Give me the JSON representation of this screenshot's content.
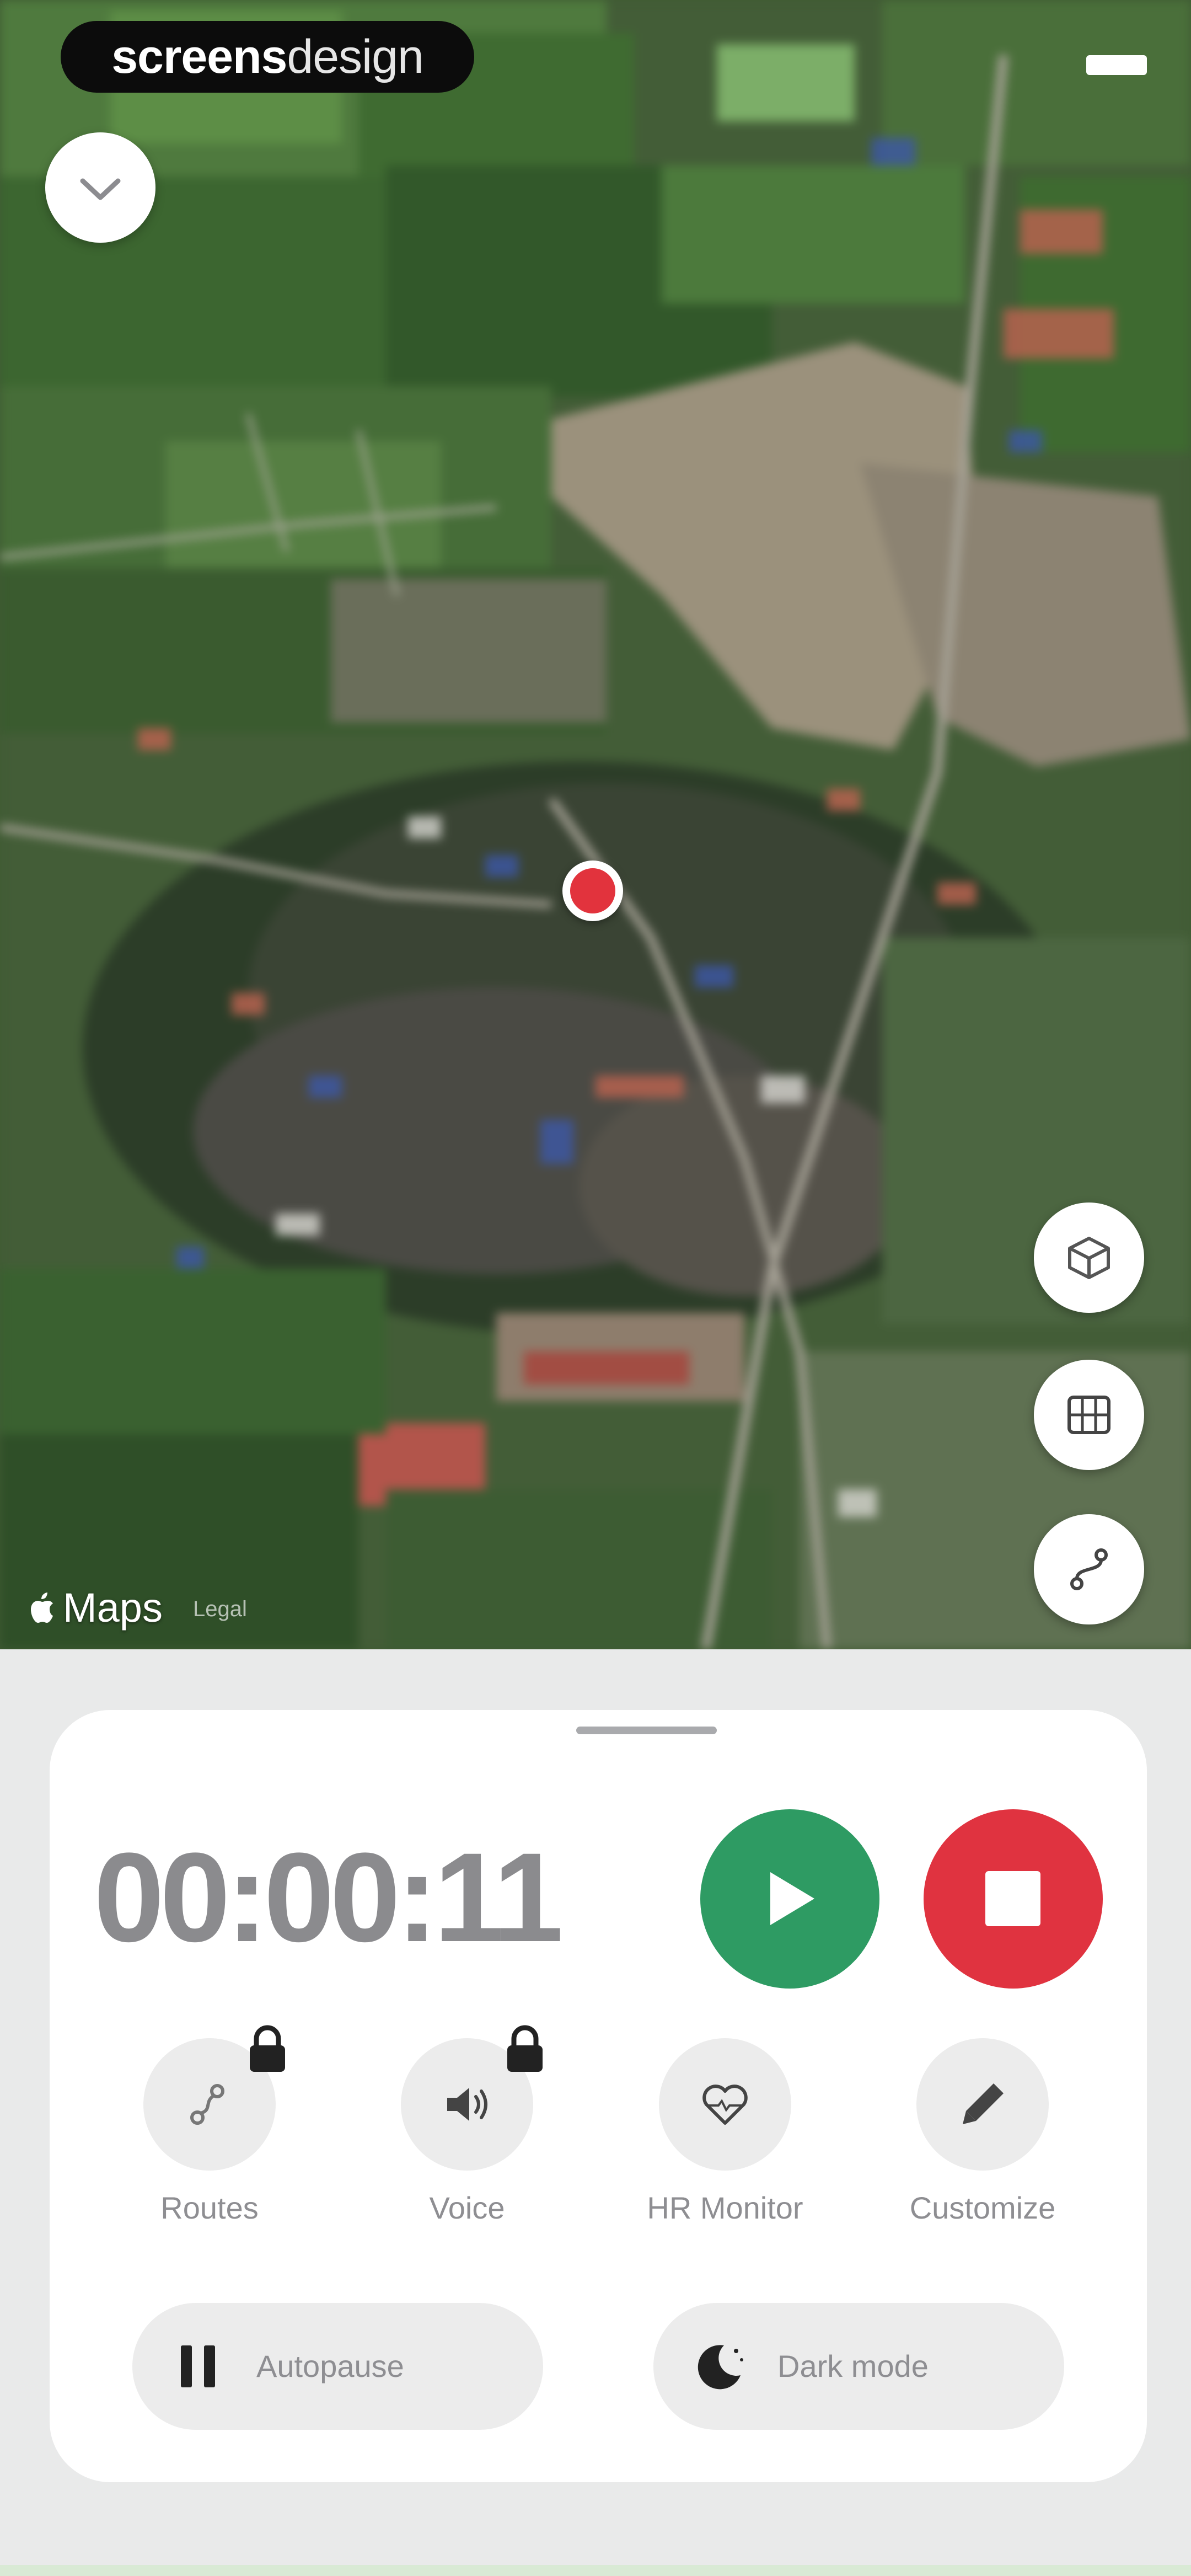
{
  "watermark": {
    "bold": "screens",
    "regular": "design"
  },
  "map": {
    "attribution": "Maps",
    "legal": "Legal",
    "controls": [
      {
        "name": "map-style-button",
        "icon": "cube-icon"
      },
      {
        "name": "map-layers-button",
        "icon": "map-grid-icon"
      },
      {
        "name": "route-button",
        "icon": "route-icon"
      }
    ]
  },
  "workout": {
    "elapsed": "00:00:11",
    "play_icon": "play-icon",
    "stop_icon": "stop-icon"
  },
  "features": [
    {
      "label": "Routes",
      "icon": "routes-icon",
      "locked": true
    },
    {
      "label": "Voice",
      "icon": "speaker-icon",
      "locked": true
    },
    {
      "label": "HR Monitor",
      "icon": "heart-icon",
      "locked": false
    },
    {
      "label": "Customize",
      "icon": "pencil-icon",
      "locked": false
    }
  ],
  "toggles": [
    {
      "label": "Autopause",
      "icon": "pause-icon"
    },
    {
      "label": "Dark mode",
      "icon": "moon-icon"
    }
  ],
  "colors": {
    "play": "#2e9b63",
    "stop": "#e03340",
    "location": "#e2333d",
    "muted_text": "#8e8e92"
  }
}
